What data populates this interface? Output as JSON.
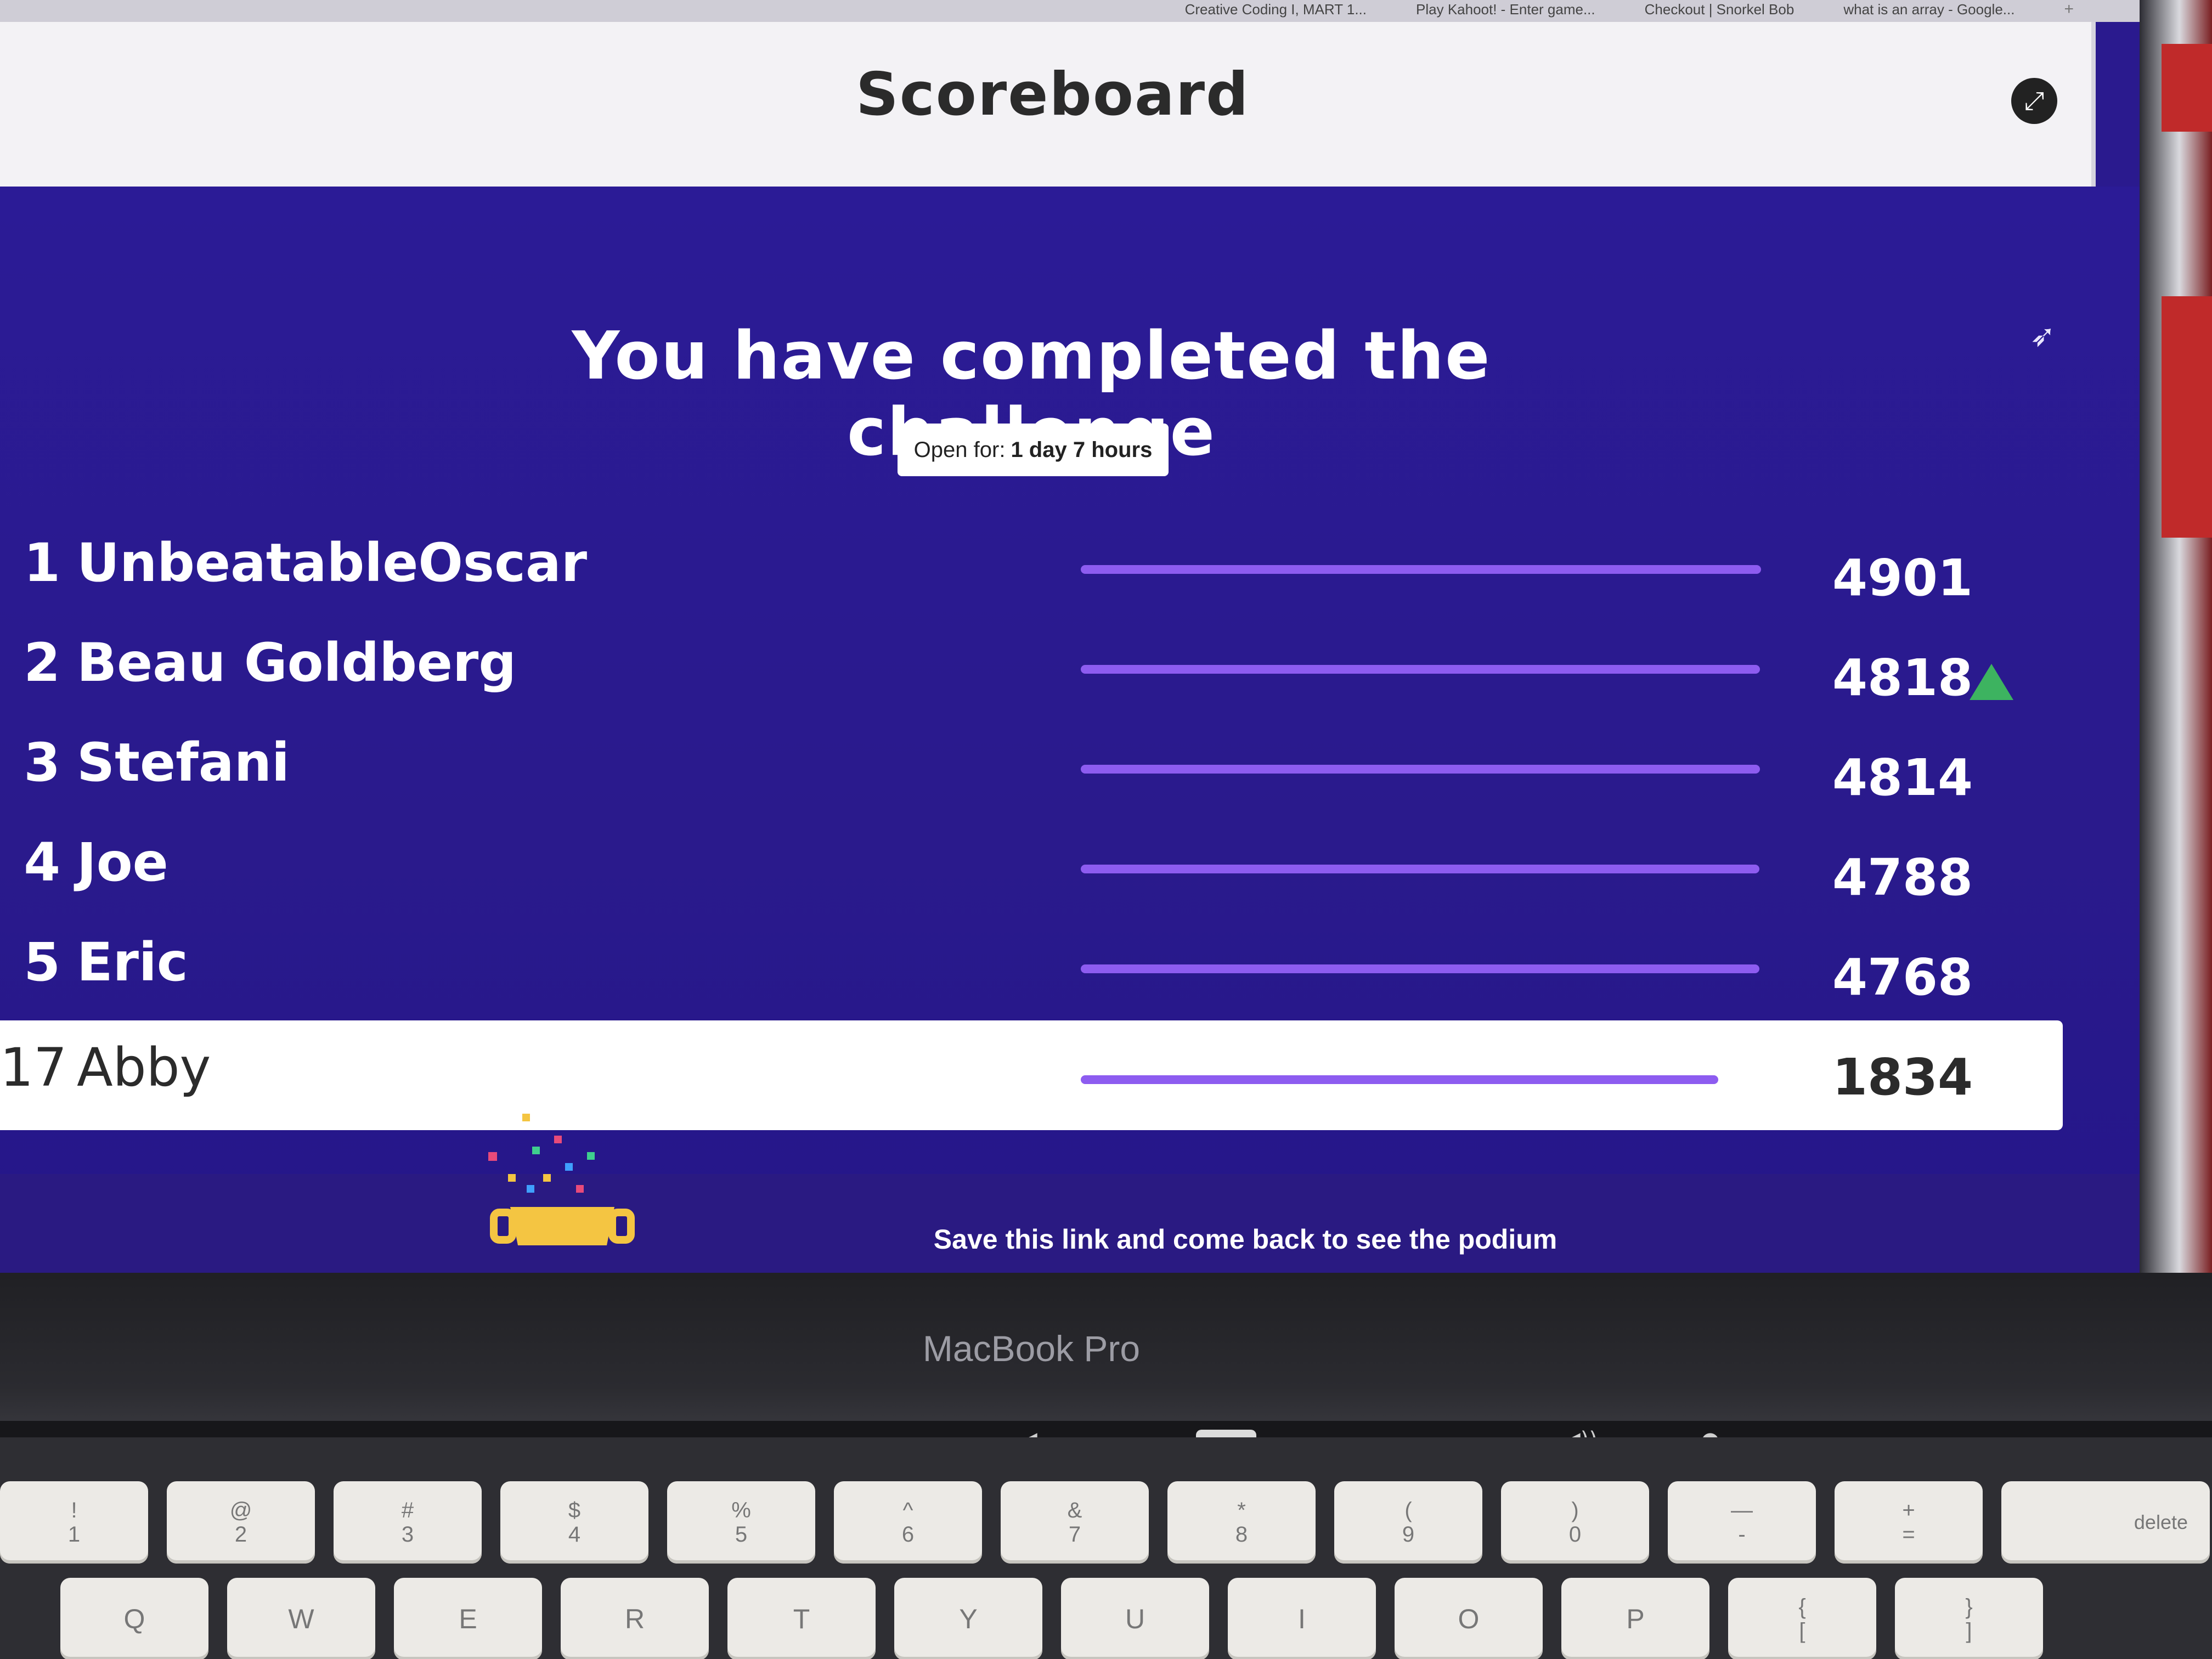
{
  "browser": {
    "tabs": [
      "Creative Coding I, MART 1...",
      "Play Kahoot! - Enter game...",
      "Checkout | Snorkel Bob",
      "what is an array - Google..."
    ],
    "new_tab_symbol": "+"
  },
  "header": {
    "title": "Scoreboard",
    "fullscreen_icon": "expand-icon"
  },
  "challenge": {
    "headline": "You have completed the challenge",
    "open_for_label": "Open for:",
    "open_for_value": "1 day 7 hours"
  },
  "scoreboard": {
    "max_score": 4901,
    "rows": [
      {
        "rank": "1",
        "name": "UnbeatableOscar",
        "score": 4901,
        "trend": ""
      },
      {
        "rank": "2",
        "name": "Beau Goldberg",
        "score": 4818,
        "trend": "up"
      },
      {
        "rank": "3",
        "name": "Stefani",
        "score": 4814,
        "trend": ""
      },
      {
        "rank": "4",
        "name": "Joe",
        "score": 4788,
        "trend": ""
      },
      {
        "rank": "5",
        "name": "Eric",
        "score": 4768,
        "trend": ""
      }
    ],
    "current_player": {
      "rank": "17",
      "name": "Abby",
      "score": 1834
    }
  },
  "footer": {
    "message": "Save this link and come back to see the podium"
  },
  "device": {
    "label": "MacBook Pro",
    "key_rows": [
      [
        "!\n1",
        "@\n2",
        "#\n3",
        "$\n4",
        "%\n5",
        "^\n6",
        "&\n7",
        "*\n8",
        "(\n9",
        ")\n0",
        "—\n-",
        "+\n=",
        "delete"
      ],
      [
        "Q",
        "W",
        "E",
        "R",
        "T",
        "Y",
        "U",
        "I",
        "O",
        "P",
        "{\n[",
        "}\n]",
        "|\n\\"
      ]
    ]
  },
  "colors": {
    "background": "#2a1a8e",
    "bar": "#8d5cf0",
    "trend_up": "#3db360",
    "header": "#f3f2f5"
  }
}
